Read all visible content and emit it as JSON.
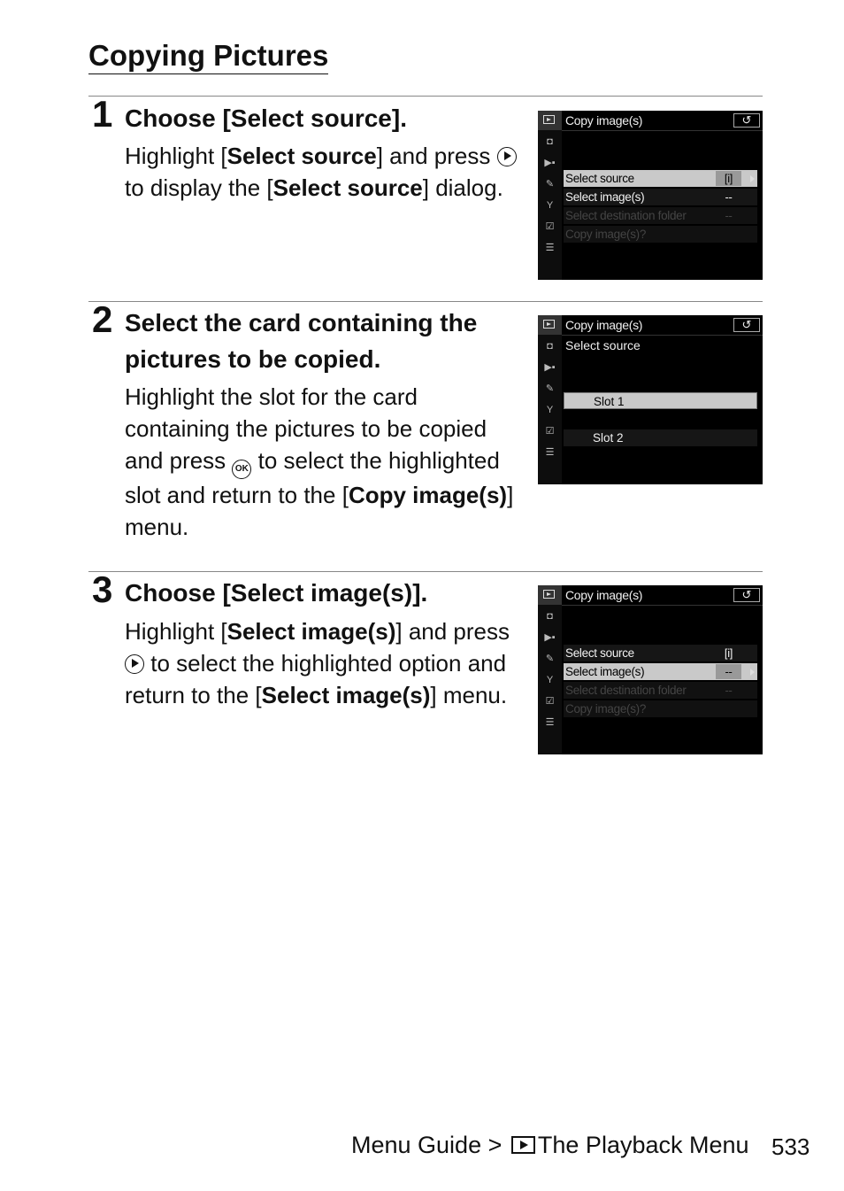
{
  "page": {
    "title": "Copying Pictures",
    "page_number": "533",
    "footer": {
      "section": "Menu Guide",
      "separator": ">",
      "icon": "playback-icon",
      "chapter": "The Playback Menu"
    }
  },
  "steps": [
    {
      "number": "1",
      "title": "Choose [Select source].",
      "body": [
        {
          "t": "Highlight ["
        },
        {
          "t": "Select source",
          "b": true
        },
        {
          "t": "] and press "
        },
        {
          "icon": "multi-selector-right"
        },
        {
          "t": " to display the ["
        },
        {
          "t": "Select source",
          "b": true
        },
        {
          "t": "] dialog."
        }
      ]
    },
    {
      "number": "2",
      "title": "Select the card containing the pictures to be copied.",
      "body": [
        {
          "t": "Highlight the slot for the card containing the pictures to be copied and press "
        },
        {
          "icon": "ok-button"
        },
        {
          "t": " to select the highlighted slot and return to the ["
        },
        {
          "t": "Copy image(s)",
          "b": true
        },
        {
          "t": "] menu."
        }
      ]
    },
    {
      "number": "3",
      "title": "Choose [Select image(s)].",
      "body": [
        {
          "t": "Highlight ["
        },
        {
          "t": "Select image(s)",
          "b": true
        },
        {
          "t": "] and press "
        },
        {
          "icon": "multi-selector-right"
        },
        {
          "t": " to select the highlighted option and return to the ["
        },
        {
          "t": "Select image(s)",
          "b": true
        },
        {
          "t": "] menu."
        }
      ]
    }
  ],
  "screens": {
    "s1": {
      "title": "Copy image(s)",
      "back": "↺",
      "rows": [
        {
          "label": "Select source",
          "value": "[i]",
          "state": "highlighted"
        },
        {
          "label": "Select image(s)",
          "value": "--",
          "state": "normal"
        },
        {
          "label": "Select destination folder",
          "value": "--",
          "state": "disabled"
        },
        {
          "label": "Copy image(s)?",
          "value": "",
          "state": "disabled"
        }
      ]
    },
    "s2": {
      "title": "Copy image(s)",
      "subtitle": "Select source",
      "back": "↺",
      "slots": [
        {
          "label": "Slot 1",
          "state": "highlighted"
        },
        {
          "label": "Slot 2",
          "state": "normal"
        }
      ]
    },
    "s3": {
      "title": "Copy image(s)",
      "back": "↺",
      "rows": [
        {
          "label": "Select source",
          "value": "[i]",
          "state": "normal"
        },
        {
          "label": "Select image(s)",
          "value": "--",
          "state": "highlighted"
        },
        {
          "label": "Select destination folder",
          "value": "--",
          "state": "disabled"
        },
        {
          "label": "Copy image(s)?",
          "value": "",
          "state": "disabled"
        }
      ]
    },
    "sidebar_icons": [
      "playback-icon",
      "camera-icon",
      "movie-icon",
      "pencil-icon",
      "wrench-icon",
      "retouch-icon",
      "my-menu-icon"
    ]
  }
}
